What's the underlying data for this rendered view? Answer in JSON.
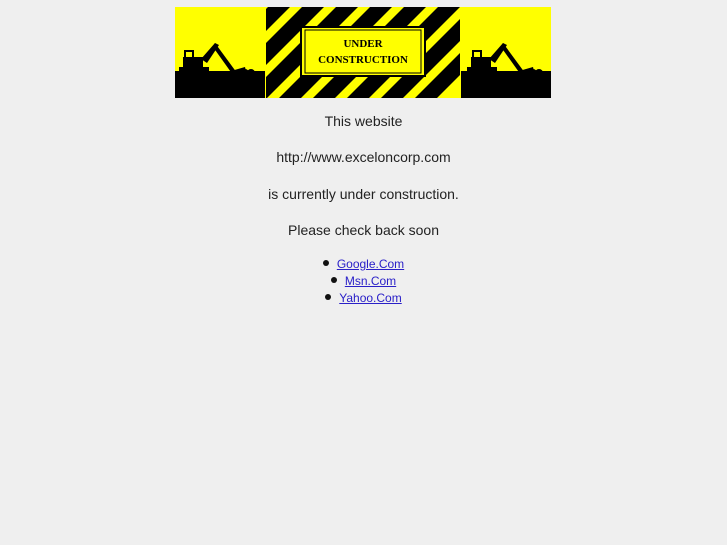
{
  "banner": {
    "line1": "UNDER",
    "line2": "CONSTRUCTION",
    "colors": {
      "yellow": "#ffff00",
      "black": "#000000"
    },
    "left_icon": "excavator-icon",
    "right_icon": "excavator-icon"
  },
  "message": {
    "line1": "This website",
    "url": "http://www.exceloncorp.com",
    "line3": "is currently under construction.",
    "line4": "Please check back soon"
  },
  "links": [
    {
      "label": "Google.Com"
    },
    {
      "label": "Msn.Com"
    },
    {
      "label": "Yahoo.Com"
    }
  ],
  "colors": {
    "background": "#efefef",
    "link": "#2a20c8"
  }
}
